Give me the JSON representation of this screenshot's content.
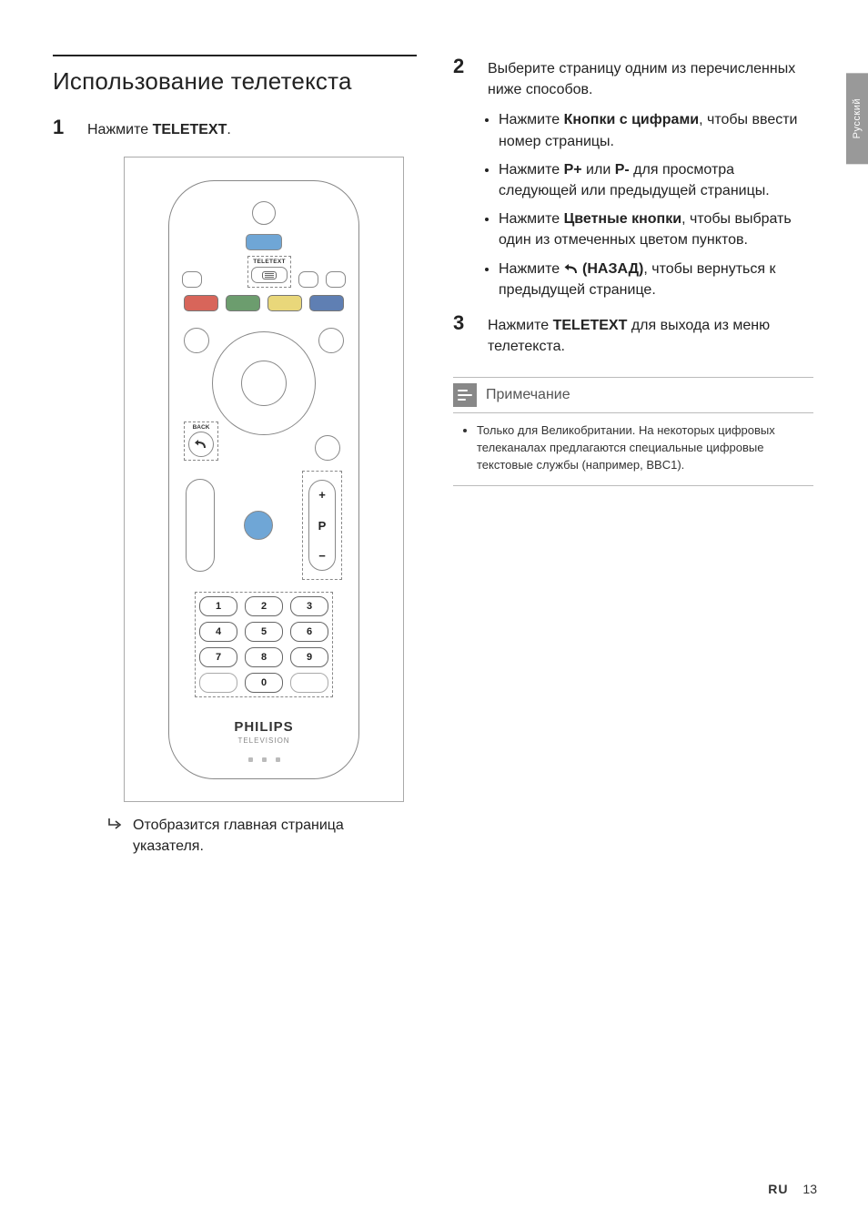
{
  "lang_tab": "Русский",
  "title": "Использование телетекста",
  "steps": {
    "s1": {
      "num": "1",
      "text_a": "Нажмите ",
      "bold": "TELETEXT",
      "text_b": "."
    },
    "result": "Отобразится главная страница указателя.",
    "s2": {
      "num": "2",
      "text": "Выберите страницу одним из перечисленных ниже способов."
    },
    "bullets": {
      "b1a": "Нажмите ",
      "b1b": "Кнопки с цифрами",
      "b1c": ", чтобы ввести номер страницы.",
      "b2a": "Нажмите ",
      "b2b": "P+",
      "b2c": " или ",
      "b2d": "P-",
      "b2e": " для просмотра следующей или предыдущей страницы.",
      "b3a": "Нажмите ",
      "b3b": "Цветные кнопки",
      "b3c": ", чтобы выбрать один из отмеченных цветом пунктов.",
      "b4a": "Нажмите ",
      "b4b": " (НАЗАД)",
      "b4c": ", чтобы вернуться к предыдущей странице."
    },
    "s3": {
      "num": "3",
      "text_a": "Нажмите ",
      "bold": "TELETEXT",
      "text_b": "  для выхода из меню телетекста."
    }
  },
  "note": {
    "title": "Примечание",
    "body": "Только для Великобритании. На некоторых цифровых телеканалах предлагаются специальные цифровые текстовые службы (например, BBC1)."
  },
  "remote": {
    "teletext_label": "TELETEXT",
    "back_label": "BACK",
    "p_plus": "+",
    "p_letter": "P",
    "p_minus": "−",
    "keys": [
      "1",
      "2",
      "3",
      "4",
      "5",
      "6",
      "7",
      "8",
      "9",
      "0"
    ],
    "brand": "PHILIPS",
    "brand_sub": "TELEVISION"
  },
  "footer": {
    "ru": "RU",
    "page": "13"
  }
}
